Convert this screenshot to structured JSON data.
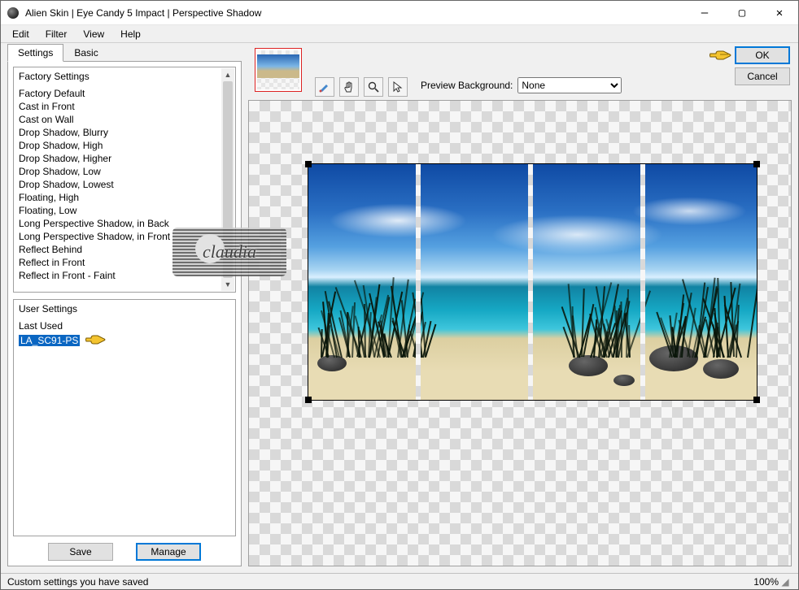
{
  "window": {
    "title": "Alien Skin | Eye Candy 5 Impact | Perspective Shadow"
  },
  "menu": {
    "edit": "Edit",
    "filter": "Filter",
    "view": "View",
    "help": "Help"
  },
  "tabs": {
    "settings": "Settings",
    "basic": "Basic"
  },
  "factory": {
    "title": "Factory Settings",
    "items": [
      "Factory Default",
      "Cast in Front",
      "Cast on Wall",
      "Drop Shadow, Blurry",
      "Drop Shadow, High",
      "Drop Shadow, Higher",
      "Drop Shadow, Low",
      "Drop Shadow, Lowest",
      "Floating, High",
      "Floating, Low",
      "Long Perspective Shadow, in Back",
      "Long Perspective Shadow, in Front",
      "Reflect Behind",
      "Reflect in Front",
      "Reflect in Front - Faint"
    ]
  },
  "user": {
    "title": "User Settings",
    "items": [
      "Last Used",
      "LA_SC91-PS"
    ],
    "selected_index": 1
  },
  "buttons": {
    "save": "Save",
    "manage": "Manage",
    "ok": "OK",
    "cancel": "Cancel"
  },
  "preview": {
    "label": "Preview Background:",
    "value": "None"
  },
  "watermark": {
    "text": "claudia"
  },
  "status": {
    "text": "Custom settings you have saved",
    "zoom": "100%"
  }
}
